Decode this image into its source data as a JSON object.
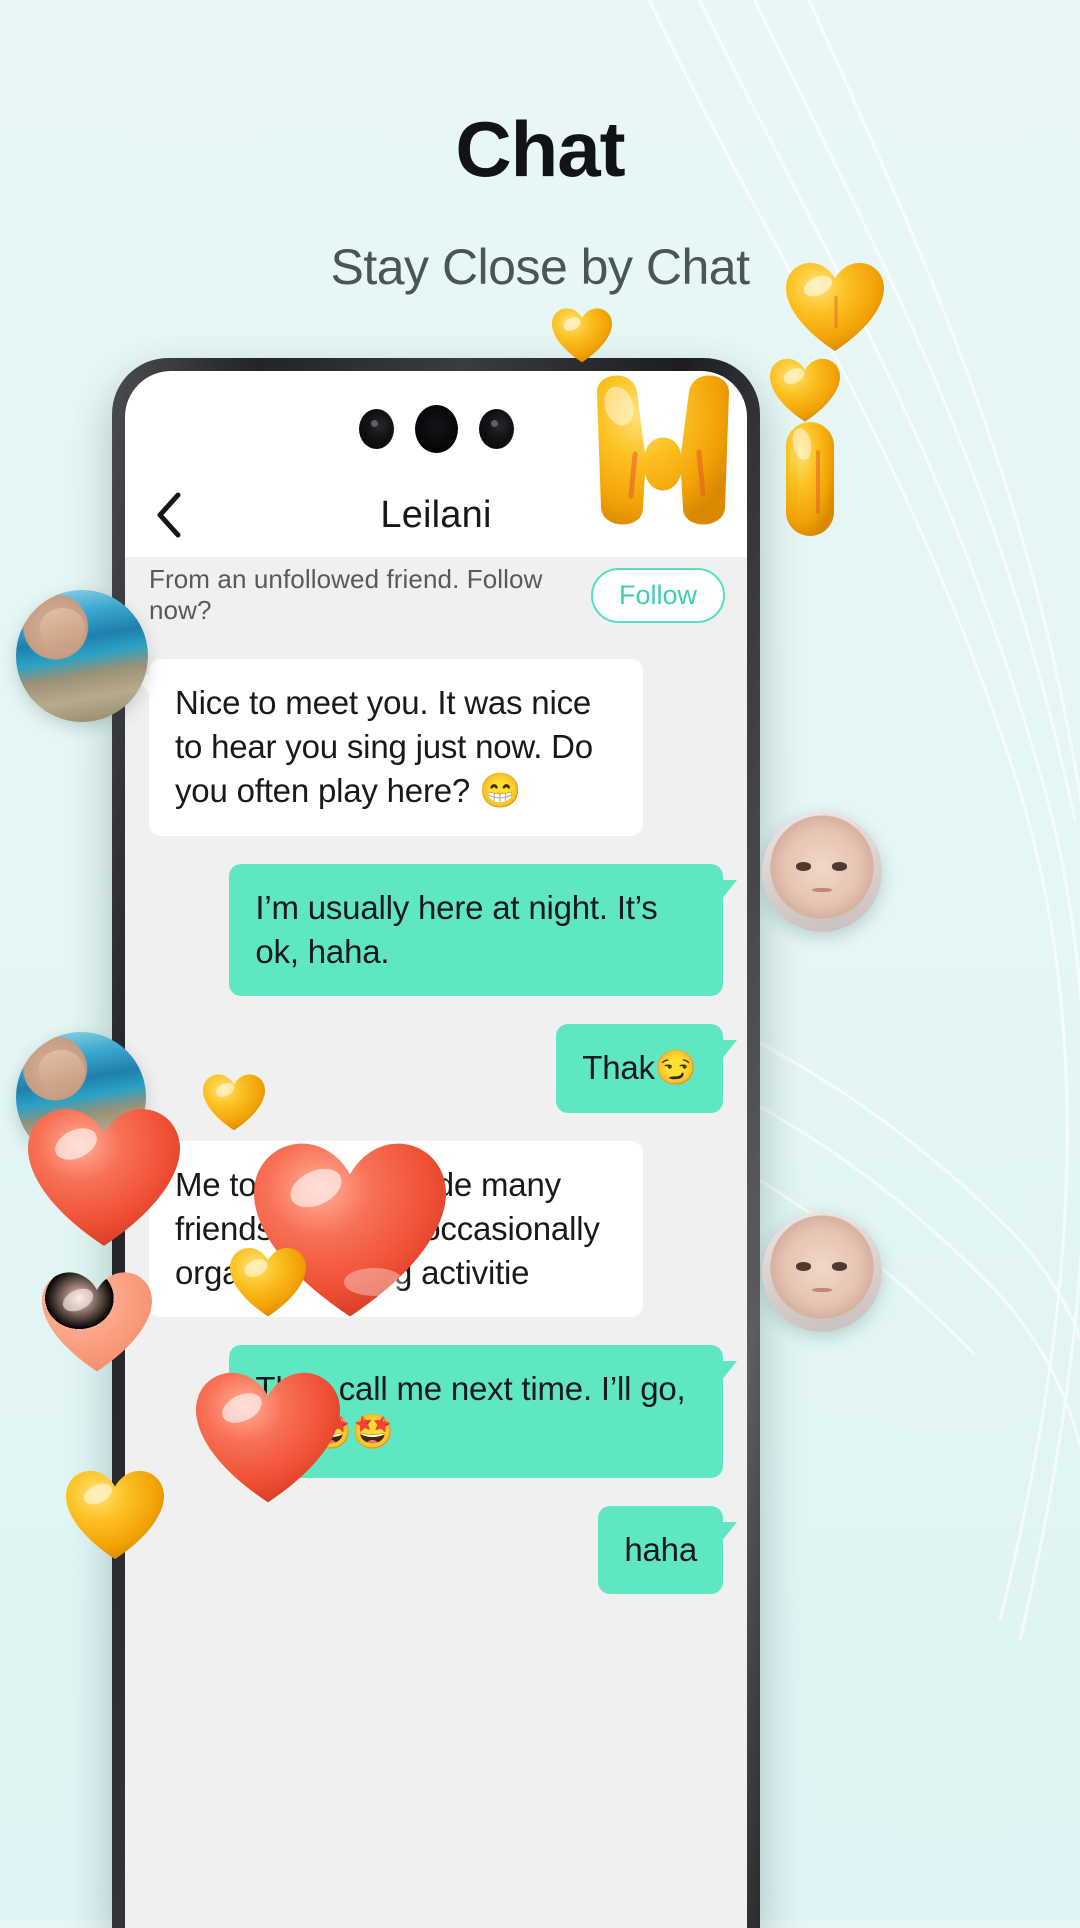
{
  "page": {
    "title": "Chat",
    "subtitle": "Stay Close by Chat",
    "background_color": "#e4f6f5",
    "accent_color": "#5fe7c3",
    "follow_border_color": "#57e0c2"
  },
  "phone": {
    "camera_dots": 3
  },
  "chat": {
    "back_icon": "chevron-left-icon",
    "contact_name": "Leilani",
    "banner": {
      "text": "From an unfollowed friend. Follow now?",
      "follow_label": "Follow"
    },
    "messages": [
      {
        "side": "in",
        "text": "Nice to meet you. It was nice to hear you sing just now. Do you often play here? ",
        "emoji": "😁"
      },
      {
        "side": "out",
        "text": "I’m usually here at night. It’s ok, haha.",
        "emoji": ""
      },
      {
        "side": "out",
        "text": "Thak",
        "emoji": "😏"
      },
      {
        "side": "in",
        "text": "Me too. I have made many friends here. We occasionally organize singing activitie",
        "emoji": ""
      },
      {
        "side": "out",
        "text": "Then call me next time. I’ll go, too.",
        "emoji": "🤩🤩"
      },
      {
        "side": "out",
        "text": "haha",
        "emoji": ""
      }
    ]
  },
  "decorations": {
    "hearts": [
      {
        "name": "yellow-heart-small-top",
        "color": "#f5b81f"
      },
      {
        "name": "yellow-heart-large-right",
        "color": "#f7a814"
      },
      {
        "name": "yellow-heart-right-upper",
        "color": "#f9b81c"
      },
      {
        "name": "yellow-heart-right-lower",
        "color": "#f7a91a"
      },
      {
        "name": "yellow-letter-m",
        "color": "#f9b01a"
      },
      {
        "name": "red-heart-left",
        "color": "#f4674f"
      },
      {
        "name": "red-heart-center",
        "color": "#f25c43"
      },
      {
        "name": "peach-heart-left",
        "color": "#fb9a7c"
      },
      {
        "name": "red-heart-bottom",
        "color": "#f4694d"
      },
      {
        "name": "yellow-heart-bottom-left",
        "color": "#f6b01d"
      },
      {
        "name": "yellow-heart-msg",
        "color": "#f7b51f"
      },
      {
        "name": "yellow-heart-msg-2",
        "color": "#f6ae1b"
      }
    ],
    "avatars": [
      {
        "name": "avatar-beach-upper"
      },
      {
        "name": "avatar-portrait-upper"
      },
      {
        "name": "avatar-beach-lower"
      },
      {
        "name": "avatar-portrait-lower"
      }
    ]
  }
}
